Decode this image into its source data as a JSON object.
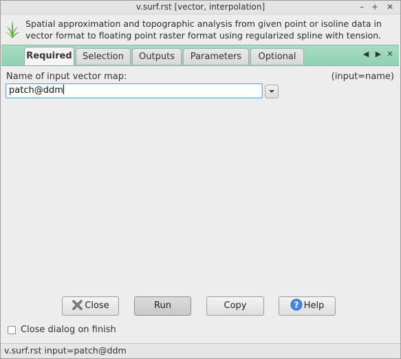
{
  "window": {
    "title": "v.surf.rst [vector, interpolation]",
    "controls": {
      "minimize": "–",
      "maximize": "+",
      "close": "✕"
    }
  },
  "header": {
    "description": "Spatial approximation and topographic analysis from given point or isoline data in vector format to floating point raster format using regularized spline with tension.",
    "logo_icon": "grass-logo-icon"
  },
  "tabs": [
    {
      "label": "Required",
      "active": true
    },
    {
      "label": "Selection",
      "active": false
    },
    {
      "label": "Outputs",
      "active": false
    },
    {
      "label": "Parameters",
      "active": false
    },
    {
      "label": "Optional",
      "active": false
    }
  ],
  "tab_controls": {
    "prev": "◀",
    "next": "▶",
    "close": "✕"
  },
  "required": {
    "field_label": "Name of input vector map:",
    "field_key": "(input=name)",
    "field_value": "patch@ddm"
  },
  "buttons": {
    "close": "Close",
    "run": "Run",
    "copy": "Copy",
    "help": "Help"
  },
  "checkbox": {
    "label": "Close dialog on finish",
    "checked": false
  },
  "status": {
    "command": "v.surf.rst input=patch@ddm"
  },
  "colors": {
    "tabbar_accent": "#96d4b8",
    "help_icon": "#2f6fd0",
    "close_icon": "#c0392b"
  }
}
